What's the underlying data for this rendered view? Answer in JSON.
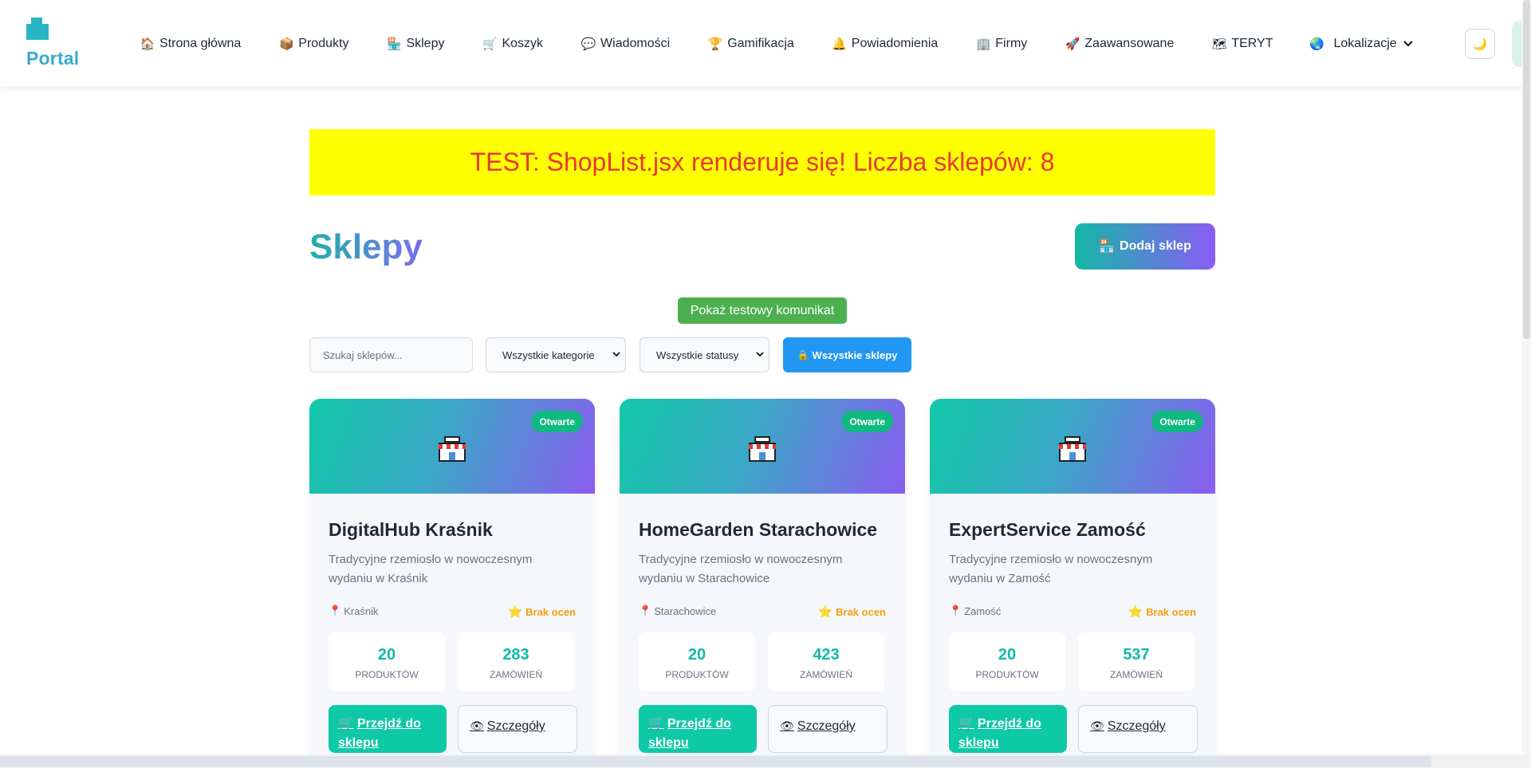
{
  "header": {
    "logo_text": "Portal",
    "nav": [
      {
        "label": "Strona główna",
        "icon": "home-icon"
      },
      {
        "label": "Produkty",
        "icon": "box-icon"
      },
      {
        "label": "Sklepy",
        "icon": "store-icon"
      },
      {
        "label": "Koszyk",
        "icon": "cart-icon"
      },
      {
        "label": "Wiadomości",
        "icon": "chat-icon"
      },
      {
        "label": "Gamifikacja",
        "icon": "trophy-icon"
      },
      {
        "label": "Powiadomienia",
        "icon": "bell-icon"
      },
      {
        "label": "Firmy",
        "icon": "building-icon"
      },
      {
        "label": "Zaawansowane",
        "icon": "rocket-icon"
      },
      {
        "label": "TERYT",
        "icon": "map-icon"
      },
      {
        "label": "Lokalizacje",
        "icon": "globe-icon"
      }
    ],
    "theme_icon": "moon-icon"
  },
  "banner": {
    "text": "TEST: ShopList.jsx renderuje się! Liczba sklepów: 8"
  },
  "page": {
    "title": "Sklepy",
    "add_button": "Dodaj sklep",
    "test_button": "Pokaż testowy komunikat"
  },
  "filters": {
    "search_placeholder": "Szukaj sklepów...",
    "category": "Wszystkie kategorie",
    "status": "Wszystkie statusy",
    "all_shops_button": "Wszystkie sklepy"
  },
  "shops": [
    {
      "name": "DigitalHub Kraśnik",
      "description": "Tradycyjne rzemiosło w nowoczesnym wydaniu w Kraśnik",
      "location": "Kraśnik",
      "rating": "Brak ocen",
      "status": "Otwarte",
      "products": "20",
      "products_label": "PRODUKTÓW",
      "orders": "283",
      "orders_label": "ZAMÓWIEŃ",
      "go_button": "Przejdź do sklepu",
      "details_button": "Szczegóły"
    },
    {
      "name": "HomeGarden Starachowice",
      "description": "Tradycyjne rzemiosło w nowoczesnym wydaniu w Starachowice",
      "location": "Starachowice",
      "rating": "Brak ocen",
      "status": "Otwarte",
      "products": "20",
      "products_label": "PRODUKTÓW",
      "orders": "423",
      "orders_label": "ZAMÓWIEŃ",
      "go_button": "Przejdź do sklepu",
      "details_button": "Szczegóły"
    },
    {
      "name": "ExpertService Zamość",
      "description": "Tradycyjne rzemiosło w nowoczesnym wydaniu w Zamość",
      "location": "Zamość",
      "rating": "Brak ocen",
      "status": "Otwarte",
      "products": "20",
      "products_label": "PRODUKTÓW",
      "orders": "537",
      "orders_label": "ZAMÓWIEŃ",
      "go_button": "Przejdź do sklepu",
      "details_button": "Szczegóły"
    }
  ]
}
